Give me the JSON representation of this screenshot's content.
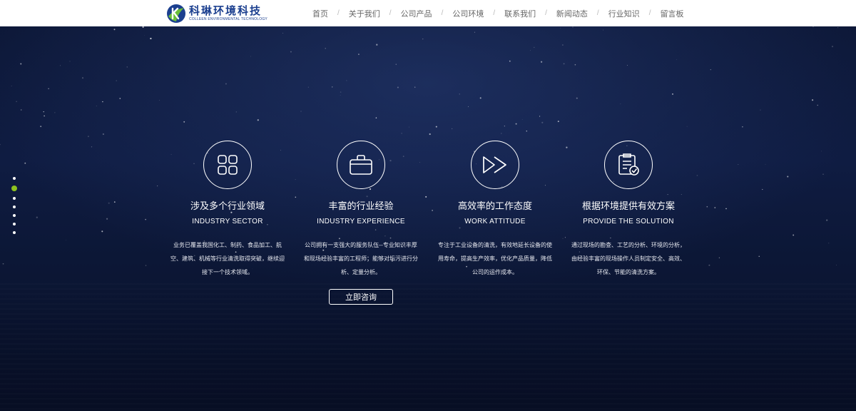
{
  "brand": {
    "name_cn": "科琳环境科技",
    "name_en": "COLLEEN ENVIRONMENTAL TECHNOLOGY",
    "logo_icon": "leaf-k-logo",
    "color": "#1b3f8f"
  },
  "nav": {
    "items": [
      "首页",
      "关于我们",
      "公司产品",
      "公司环境",
      "联系我们",
      "新闻动态",
      "行业知识",
      "留言板"
    ],
    "separator": "/"
  },
  "pager": {
    "count": 7,
    "active_index": 1,
    "active_color": "#8dc21f"
  },
  "features": [
    {
      "icon": "grid-icon",
      "title": "涉及多个行业领域",
      "subtitle": "INDUSTRY SECTOR",
      "desc": "业务已覆盖我国化工、制药、食品加工、航空、建筑、机械等行业清洗取得突破，继续迎接下一个技术领域。"
    },
    {
      "icon": "briefcase-icon",
      "title": "丰富的行业经验",
      "subtitle": "INDUSTRY EXPERIENCE",
      "desc": "公司拥有一支强大的服务队伍--专业知识丰厚和现场经验丰富的工程师；能够对垢污进行分析、定量分析。"
    },
    {
      "icon": "fast-forward-icon",
      "title": "高效率的工作态度",
      "subtitle": "WORK ATTITUDE",
      "desc": "专注于工业设备的清洗，有效地延长设备的使用寿命，提高生产效率，优化产品质量，降低公司的运作成本。"
    },
    {
      "icon": "checklist-icon",
      "title": "根据环境提供有效方案",
      "subtitle": "PROVIDE THE SOLUTION",
      "desc": "通过现场的勘查、工艺的分析、环境的分析，由经验丰富的现场操作人员制定安全、高效、环保、节能的清洗方案。"
    }
  ],
  "cta": {
    "label": "立即咨询"
  }
}
